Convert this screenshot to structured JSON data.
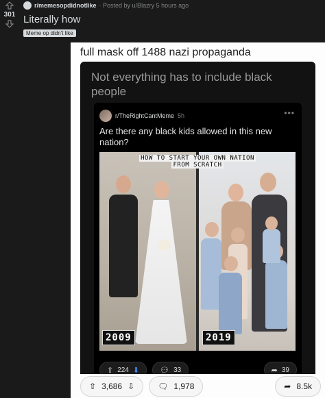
{
  "post": {
    "subreddit": "r/memesopdidnotlike",
    "posted_by": "· Posted by u/Blazry 5 hours ago",
    "score": "301",
    "title": "Literally how",
    "flair": "Meme op didn't like"
  },
  "image": {
    "caption": "full mask off 1488 nazi propaganda",
    "phone_title": "Not everything has to include black people",
    "inner_post": {
      "subreddit": "r/TheRightCantMeme",
      "time": "5h",
      "more": "•••",
      "title": "Are there any black kids allowed in this new nation?",
      "meme": {
        "header_line1": "HOW TO START YOUR OWN NATION",
        "header_line2": "FROM SCRATCH",
        "left_year": "2009",
        "right_year": "2019"
      },
      "actions": {
        "upvotes": "224",
        "comments": "33",
        "shares": "39"
      }
    },
    "bottom": {
      "upvotes": "3,686",
      "comments": "1,978",
      "shares": "8.5k"
    }
  }
}
